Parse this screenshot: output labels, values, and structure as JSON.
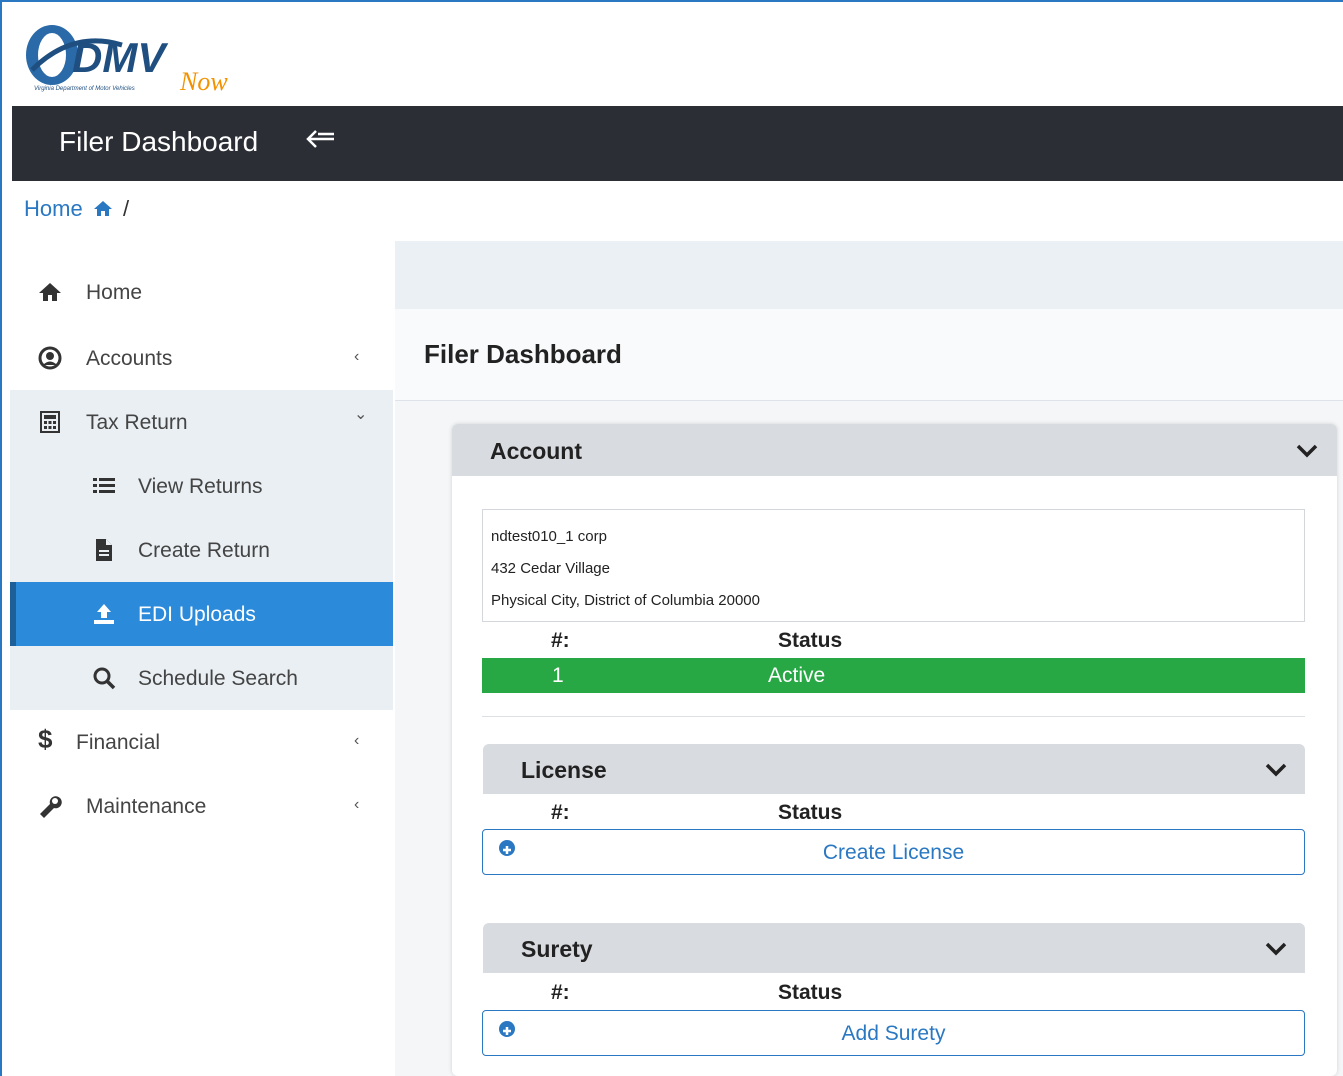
{
  "brand": {
    "logo_text": "DMV",
    "logo_sub": "Now",
    "logo_tagline": "Virginia Department of Motor Vehicles"
  },
  "topbar": {
    "title": "Filer Dashboard",
    "collapse_icon": "arrow-left-icon"
  },
  "breadcrumb": {
    "home": "Home",
    "separator": "/"
  },
  "sidebar": {
    "items": [
      {
        "label": "Home",
        "icon": "home-icon"
      },
      {
        "label": "Accounts",
        "icon": "user-circle-icon",
        "caret": "‹"
      },
      {
        "label": "Tax Return",
        "icon": "calculator-icon",
        "caret": "⌄"
      },
      {
        "label": "Financial",
        "icon": "dollar-icon",
        "caret": "‹"
      },
      {
        "label": "Maintenance",
        "icon": "wrench-icon",
        "caret": "‹"
      }
    ],
    "sub_items": [
      {
        "label": "View Returns",
        "icon": "list-icon"
      },
      {
        "label": "Create Return",
        "icon": "file-icon"
      },
      {
        "label": "EDI Uploads",
        "icon": "upload-icon"
      },
      {
        "label": "Schedule Search",
        "icon": "search-icon"
      }
    ]
  },
  "main": {
    "title": "Filer Dashboard",
    "account": {
      "title": "Account",
      "address_lines": [
        "ndtest010_1 corp",
        "432 Cedar Village",
        "Physical City, District of Columbia 20000"
      ],
      "col_num": "#:",
      "col_status": "Status",
      "row_num": "1",
      "row_status": "Active"
    },
    "license": {
      "title": "License",
      "col_num": "#:",
      "col_status": "Status",
      "action": "Create License"
    },
    "surety": {
      "title": "Surety",
      "col_num": "#:",
      "col_status": "Status",
      "action": "Add Surety"
    }
  },
  "colors": {
    "topbar_bg": "#2b2f35",
    "link_blue": "#2a78c2",
    "active_blue": "#2b8ad9",
    "status_green": "#28a745",
    "logo_orange": "#f39200"
  }
}
